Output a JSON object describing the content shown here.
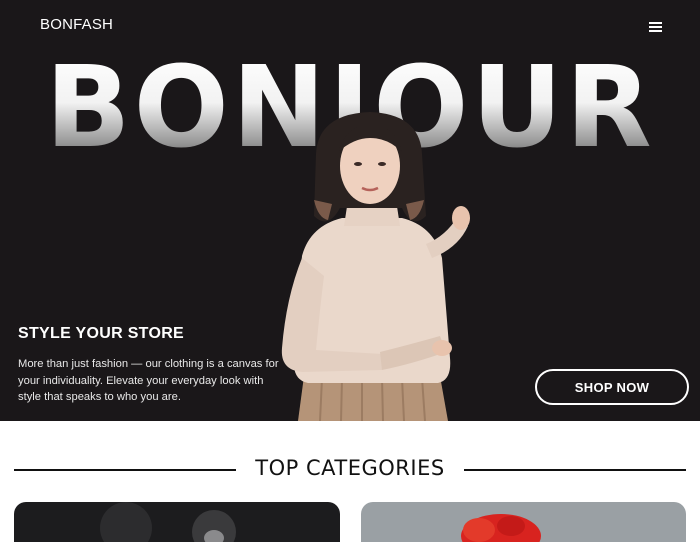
{
  "header": {
    "brand": "BONFASH",
    "menu_icon": "hamburger-menu-icon"
  },
  "hero": {
    "headline": "BONJOUR",
    "tagline": "STYLE YOUR STORE",
    "description": "More than just fashion — our clothing is a canvas for your individuality. Elevate your everyday look with style that speaks to who you are.",
    "cta_label": "SHOP NOW",
    "colors": {
      "background": "#1a1719",
      "text": "#ffffff"
    }
  },
  "categories": {
    "title": "TOP CATEGORIES"
  }
}
